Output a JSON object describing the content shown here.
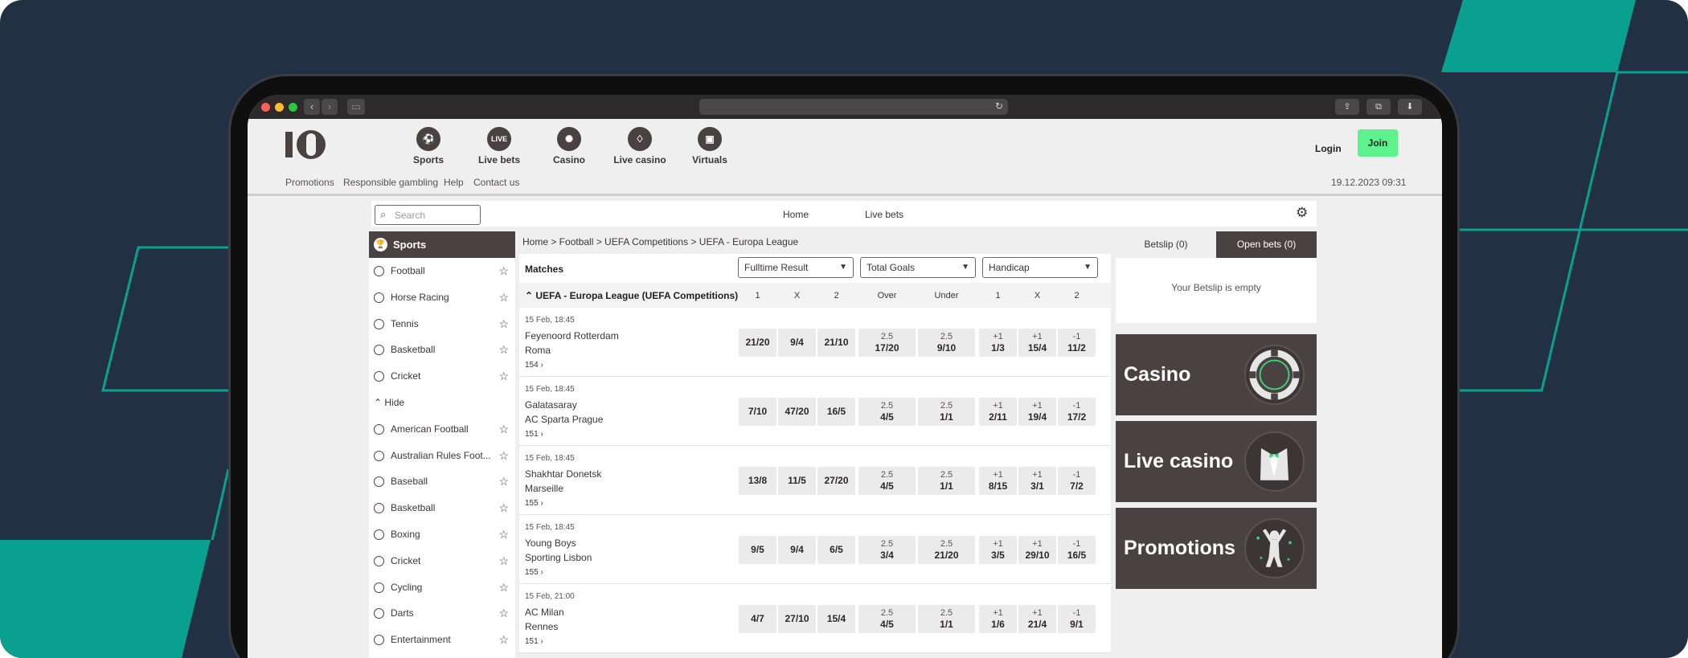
{
  "header": {
    "nav": [
      {
        "label": "Sports",
        "icon": "sports-ball-icon"
      },
      {
        "label": "Live bets",
        "icon": "live-icon",
        "badge": "LIVE"
      },
      {
        "label": "Casino",
        "icon": "casino-chip-icon"
      },
      {
        "label": "Live casino",
        "icon": "tuxedo-icon"
      },
      {
        "label": "Virtuals",
        "icon": "tv-icon"
      }
    ],
    "login_label": "Login",
    "join_label": "Join"
  },
  "subnav": {
    "links": [
      "Promotions",
      "Responsible gambling",
      "Help",
      "Contact us"
    ],
    "datetime": "19.12.2023 09:31"
  },
  "searchbar": {
    "placeholder": "Search",
    "tabs": [
      "Home",
      "Live bets"
    ]
  },
  "sidebar": {
    "title": "Sports",
    "top_items": [
      "Football",
      "Horse Racing",
      "Tennis",
      "Basketball",
      "Cricket"
    ],
    "hide_label": "Hide",
    "more_items": [
      "American Football",
      "Australian Rules Foot...",
      "Baseball",
      "Basketball",
      "Boxing",
      "Cricket",
      "Cycling",
      "Darts",
      "Entertainment"
    ]
  },
  "main": {
    "breadcrumb": "Home > Football > UEFA Competitions > UEFA - Europa League",
    "title": "Matches",
    "selects": [
      "Fulltime Result",
      "Total Goals",
      "Handicap"
    ],
    "league": "UEFA - Europa League (UEFA Competitions)",
    "columns": [
      "1",
      "X",
      "2",
      "Over",
      "Under",
      "1",
      "X",
      "2"
    ],
    "matches": [
      {
        "time": "15 Feb, 18:45",
        "home": "Feyenoord Rotterdam",
        "away": "Roma",
        "count": "154",
        "ft": [
          "21/20",
          "9/4",
          "21/10"
        ],
        "ou_line": [
          "2.5",
          "2.5"
        ],
        "ou": [
          "17/20",
          "9/10"
        ],
        "hc_line": [
          "+1",
          "+1",
          "-1"
        ],
        "hc": [
          "1/3",
          "15/4",
          "11/2"
        ]
      },
      {
        "time": "15 Feb, 18:45",
        "home": "Galatasaray",
        "away": "AC Sparta Prague",
        "count": "151",
        "ft": [
          "7/10",
          "47/20",
          "16/5"
        ],
        "ou_line": [
          "2.5",
          "2.5"
        ],
        "ou": [
          "4/5",
          "1/1"
        ],
        "hc_line": [
          "+1",
          "+1",
          "-1"
        ],
        "hc": [
          "2/11",
          "19/4",
          "17/2"
        ]
      },
      {
        "time": "15 Feb, 18:45",
        "home": "Shakhtar Donetsk",
        "away": "Marseille",
        "count": "155",
        "ft": [
          "13/8",
          "11/5",
          "27/20"
        ],
        "ou_line": [
          "2.5",
          "2.5"
        ],
        "ou": [
          "4/5",
          "1/1"
        ],
        "hc_line": [
          "+1",
          "+1",
          "-1"
        ],
        "hc": [
          "8/15",
          "3/1",
          "7/2"
        ]
      },
      {
        "time": "15 Feb, 18:45",
        "home": "Young Boys",
        "away": "Sporting Lisbon",
        "count": "155",
        "ft": [
          "9/5",
          "9/4",
          "6/5"
        ],
        "ou_line": [
          "2.5",
          "2.5"
        ],
        "ou": [
          "3/4",
          "21/20"
        ],
        "hc_line": [
          "+1",
          "+1",
          "-1"
        ],
        "hc": [
          "3/5",
          "29/10",
          "16/5"
        ]
      },
      {
        "time": "15 Feb, 21:00",
        "home": "AC Milan",
        "away": "Rennes",
        "count": "151",
        "ft": [
          "4/7",
          "27/10",
          "15/4"
        ],
        "ou_line": [
          "2.5",
          "2.5"
        ],
        "ou": [
          "4/5",
          "1/1"
        ],
        "hc_line": [
          "+1",
          "+1",
          "-1"
        ],
        "hc": [
          "1/6",
          "21/4",
          "9/1"
        ]
      }
    ]
  },
  "betslip": {
    "tabs": [
      "Betslip (0)",
      "Open bets (0)"
    ],
    "empty_text": "Your Betslip is empty"
  },
  "promos": [
    {
      "label": "Casino",
      "icon": "poker-chip-icon"
    },
    {
      "label": "Live casino",
      "icon": "tuxedo-icon"
    },
    {
      "label": "Promotions",
      "icon": "celebrating-person-icon"
    }
  ],
  "colors": {
    "background": "#213043",
    "accent_teal": "#0aa08f",
    "join_green": "#5df28e",
    "brand_dark": "#4a4142"
  }
}
